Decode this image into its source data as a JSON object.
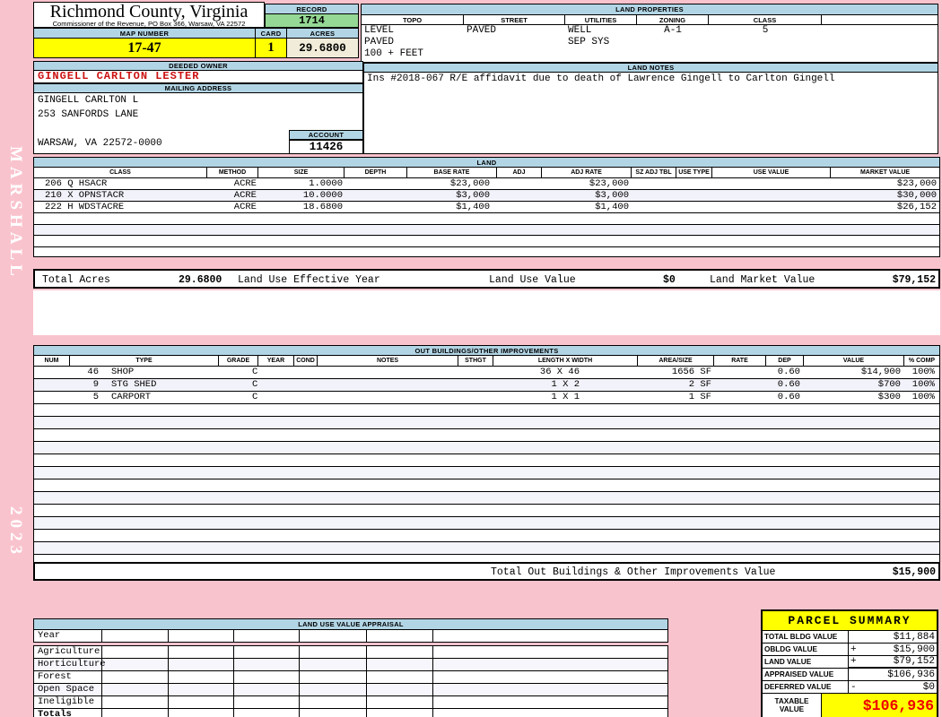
{
  "colors": {
    "page_background": "#f9c3cd",
    "header_bar": "#b2d5e5",
    "record_green": "#95d895",
    "highlight_yellow": "#ffff00",
    "acres_cream": "#f0ecd9",
    "owner_red": "#cc1111",
    "taxable_red": "#ee0000"
  },
  "sidebar": {
    "vendor": "MARSHALL",
    "year": "2023"
  },
  "header": {
    "county": "Richmond County, Virginia",
    "subtitle": "Commissioner of the Revenue, PO Box 366, Warsaw, VA 22572",
    "record_label": "RECORD",
    "record": "1714",
    "map_number_label": "MAP NUMBER",
    "map_number": "17-47",
    "card_label": "CARD",
    "card": "1",
    "acres_label": "ACRES",
    "acres": "29.6800"
  },
  "land_properties": {
    "title": "LAND PROPERTIES",
    "columns": [
      "TOPO",
      "STREET",
      "UTILITIES",
      "ZONING",
      "CLASS"
    ],
    "topo": [
      "LEVEL",
      "PAVED",
      "100 + FEET"
    ],
    "street": "PAVED",
    "utilities": [
      "WELL",
      "SEP SYS"
    ],
    "zoning": "A-1",
    "class": "5"
  },
  "owner": {
    "deeded_owner_label": "DEEDED OWNER",
    "name": "GINGELL CARLTON LESTER",
    "mailing_label": "MAILING ADDRESS",
    "address_lines": [
      "GINGELL CARLTON L",
      "253 SANFORDS LANE",
      "",
      "WARSAW, VA 22572-0000"
    ],
    "account_label": "ACCOUNT",
    "account": "11426"
  },
  "land_notes": {
    "title": "LAND NOTES",
    "text": "Ins #2018-067 R/E affidavit due to death of Lawrence Gingell to Carlton Gingell"
  },
  "land": {
    "title": "LAND",
    "columns": [
      "CLASS",
      "METHOD",
      "SIZE",
      "DEPTH",
      "BASE RATE",
      "ADJ",
      "ADJ RATE",
      "SZ ADJ TBL",
      "USE TYPE",
      "USE VALUE",
      "MARKET VALUE"
    ],
    "rows": [
      {
        "class": "206 Q HSACR",
        "method": "ACRE",
        "size": "1.0000",
        "base_rate": "$23,000",
        "adj_rate": "$23,000",
        "market_value": "$23,000"
      },
      {
        "class": "210 X OPNSTACR",
        "method": "ACRE",
        "size": "10.0000",
        "base_rate": "$3,000",
        "adj_rate": "$3,000",
        "market_value": "$30,000"
      },
      {
        "class": "222 H WDSTACRE",
        "method": "ACRE",
        "size": "18.6800",
        "base_rate": "$1,400",
        "adj_rate": "$1,400",
        "market_value": "$26,152"
      }
    ],
    "totals": {
      "total_acres_label": "Total Acres",
      "total_acres": "29.6800",
      "effective_year_label": "Land Use Effective Year",
      "use_value_label": "Land Use Value",
      "use_value": "$0",
      "market_value_label": "Land Market Value",
      "market_value": "$79,152"
    }
  },
  "out_buildings": {
    "title": "OUT BUILDINGS/OTHER IMPROVEMENTS",
    "columns": [
      "NUM",
      "TYPE",
      "GRADE",
      "YEAR",
      "COND",
      "NOTES",
      "STHGT",
      "LENGTH X WIDTH",
      "AREA/SIZE",
      "RATE",
      "DEP",
      "VALUE",
      "% COMP"
    ],
    "rows": [
      {
        "num": "46",
        "type": "SHOP",
        "grade": "C",
        "length_width": "36 X 46",
        "area": "1656 SF",
        "dep": "0.60",
        "value": "$14,900",
        "comp": "100%"
      },
      {
        "num": "9",
        "type": "STG SHED",
        "grade": "C",
        "length_width": "1 X 2",
        "area": "2 SF",
        "dep": "0.60",
        "value": "$700",
        "comp": "100%"
      },
      {
        "num": "5",
        "type": "CARPORT",
        "grade": "C",
        "length_width": "1 X 1",
        "area": "1 SF",
        "dep": "0.60",
        "value": "$300",
        "comp": "100%"
      }
    ],
    "total_label": "Total Out Buildings & Other Improvements Value",
    "total_value": "$15,900"
  },
  "land_use_appraisal": {
    "title": "LAND USE VALUE APPRAISAL",
    "row_labels": [
      "Year",
      "Agriculture",
      "Horticulture",
      "Forest",
      "Open Space",
      "Ineligible",
      "Totals"
    ]
  },
  "parcel_summary": {
    "title": "PARCEL SUMMARY",
    "rows": [
      {
        "label": "TOTAL BLDG VALUE",
        "op": "",
        "value": "$11,884"
      },
      {
        "label": "OBLDG VALUE",
        "op": "+",
        "value": "$15,900"
      },
      {
        "label": "LAND VALUE",
        "op": "+",
        "value": "$79,152"
      },
      {
        "label": "APPRAISED VALUE",
        "op": "",
        "value": "$106,936"
      },
      {
        "label": "DEFERRED VALUE",
        "op": "-",
        "value": "$0"
      }
    ],
    "taxable_label_line1": "TAXABLE",
    "taxable_label_line2": "VALUE",
    "taxable_value": "$106,936"
  }
}
